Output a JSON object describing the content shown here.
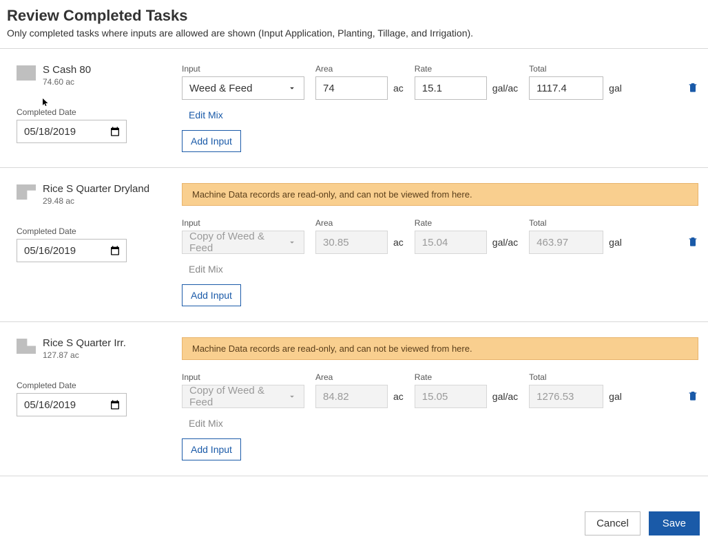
{
  "header": {
    "title": "Review Completed Tasks",
    "subtitle": "Only completed tasks where inputs are allowed are shown (Input Application, Planting, Tillage, and Irrigation)."
  },
  "labels": {
    "completed_date": "Completed Date",
    "input": "Input",
    "area": "Area",
    "rate": "Rate",
    "total": "Total",
    "area_unit": "ac",
    "rate_unit": "gal/ac",
    "total_unit": "gal",
    "edit_mix": "Edit Mix",
    "add_input": "Add Input",
    "machine_data_warning": "Machine Data records are read-only, and can not be viewed from here."
  },
  "tasks": [
    {
      "field_name": "S Cash 80",
      "acres": "74.60 ac",
      "date": "05/18/2019",
      "readonly": false,
      "input": "Weed & Feed",
      "area": "74",
      "rate": "15.1",
      "total": "1117.4"
    },
    {
      "field_name": "Rice S Quarter Dryland",
      "acres": "29.48 ac",
      "date": "05/16/2019",
      "readonly": true,
      "input": "Copy of Weed & Feed",
      "area": "30.85",
      "rate": "15.04",
      "total": "463.97"
    },
    {
      "field_name": "Rice S Quarter Irr.",
      "acres": "127.87 ac",
      "date": "05/16/2019",
      "readonly": true,
      "input": "Copy of Weed & Feed",
      "area": "84.82",
      "rate": "15.05",
      "total": "1276.53"
    }
  ],
  "footer": {
    "cancel": "Cancel",
    "save": "Save"
  }
}
